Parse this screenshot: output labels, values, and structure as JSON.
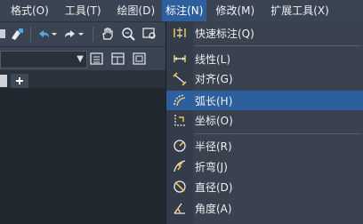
{
  "menubar": {
    "items": [
      {
        "label": "格式(O)"
      },
      {
        "label": "工具(T)"
      },
      {
        "label": "绘图(D)"
      },
      {
        "label": "标注(N)"
      },
      {
        "label": "修改(M)"
      },
      {
        "label": "扩展工具(X)"
      }
    ],
    "active_index": 3
  },
  "dim_menu": {
    "items": [
      {
        "label": "快速标注(Q)",
        "icon": "quick-dimension-icon"
      },
      {
        "label": "线性(L)",
        "icon": "linear-dimension-icon"
      },
      {
        "label": "对齐(G)",
        "icon": "aligned-dimension-icon"
      },
      {
        "label": "弧长(H)",
        "icon": "arc-length-icon"
      },
      {
        "label": "坐标(O)",
        "icon": "ordinate-dimension-icon"
      },
      {
        "label": "半径(R)",
        "icon": "radius-dimension-icon"
      },
      {
        "label": "折弯(J)",
        "icon": "jogged-dimension-icon"
      },
      {
        "label": "直径(D)",
        "icon": "diameter-dimension-icon"
      },
      {
        "label": "角度(A)",
        "icon": "angular-dimension-icon"
      }
    ],
    "hover_index": 3
  },
  "colors": {
    "menubar_bg": "#3b4453",
    "highlight": "#2d5f9c",
    "dropdown_bg": "#3a4250",
    "canvas_bg": "#212830"
  }
}
